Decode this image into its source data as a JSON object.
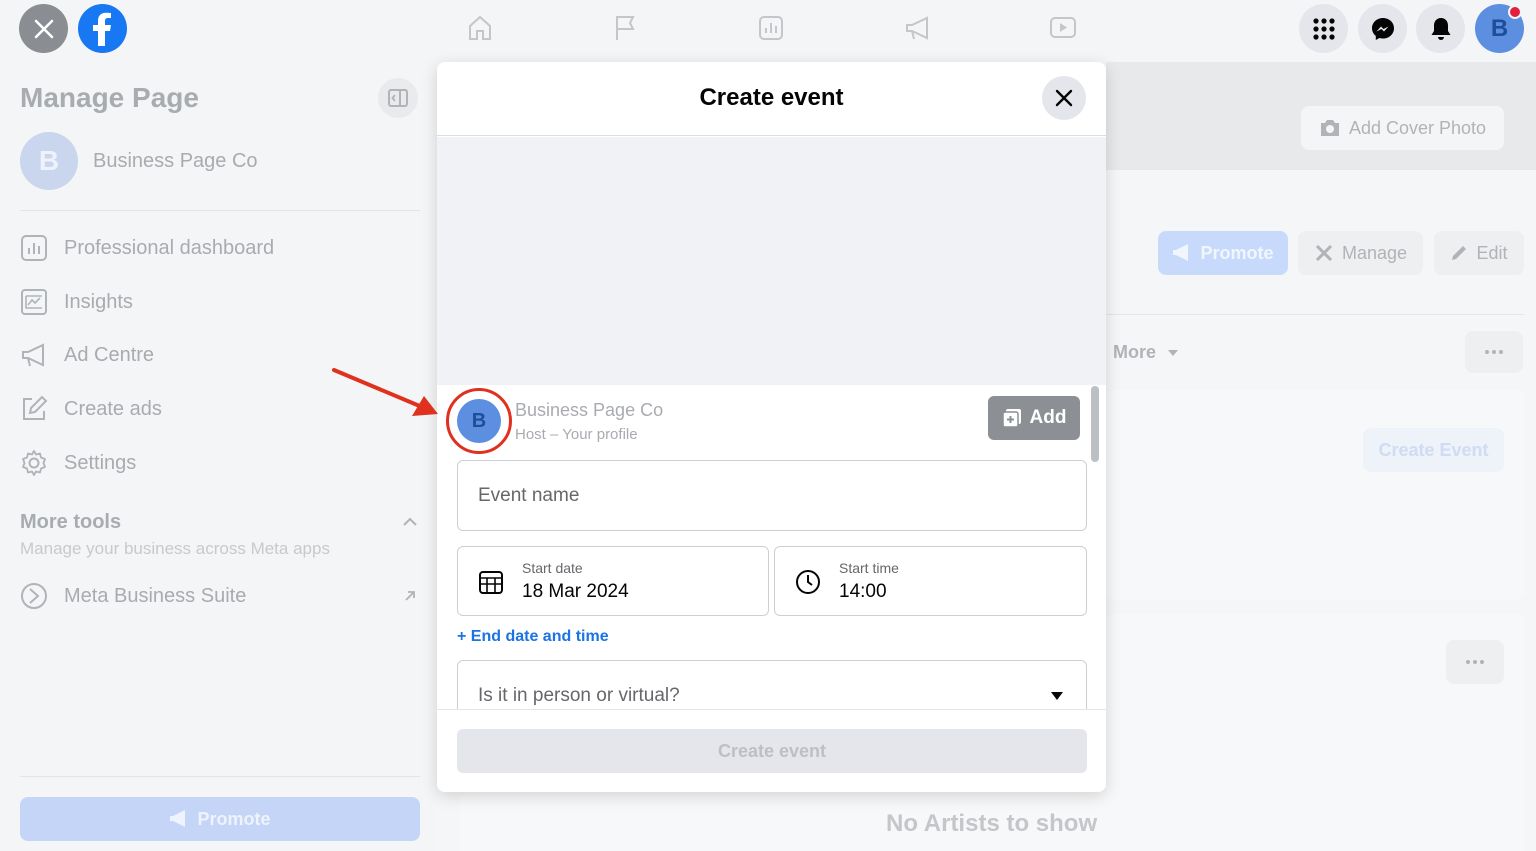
{
  "topbar": {
    "avatar_letter": "B"
  },
  "sidebar": {
    "title": "Manage Page",
    "page_avatar_letter": "B",
    "page_name": "Business Page Co",
    "items": [
      {
        "label": "Professional dashboard",
        "icon": "dashboard-icon"
      },
      {
        "label": "Insights",
        "icon": "insights-icon"
      },
      {
        "label": "Ad Centre",
        "icon": "megaphone-icon"
      },
      {
        "label": "Create ads",
        "icon": "edit-icon"
      },
      {
        "label": "Settings",
        "icon": "gear-icon"
      }
    ],
    "more_tools": {
      "title": "More tools",
      "subtitle": "Manage your business across Meta apps"
    },
    "meta_business_suite": "Meta Business Suite",
    "promote_label": "Promote"
  },
  "background": {
    "add_cover_photo": "Add Cover Photo",
    "promote": "Promote",
    "manage": "Manage",
    "edit": "Edit",
    "more": "More",
    "create_event": "Create Event",
    "no_artists": "No Artists to show"
  },
  "modal": {
    "title": "Create event",
    "add_label": "Add",
    "host": {
      "avatar_letter": "B",
      "name": "Business Page Co",
      "subtitle": "Host – Your profile"
    },
    "event_name_placeholder": "Event name",
    "start_date": {
      "label": "Start date",
      "value": "18 Mar 2024"
    },
    "start_time": {
      "label": "Start time",
      "value": "14:00"
    },
    "end_link": "+ End date and time",
    "location_placeholder": "Is it in person or virtual?",
    "create_button": "Create event"
  },
  "colors": {
    "facebook_blue": "#1877f2",
    "link_blue": "#1b74e4",
    "highlight_red": "#e0301e",
    "notification_red": "#e41e3f"
  }
}
